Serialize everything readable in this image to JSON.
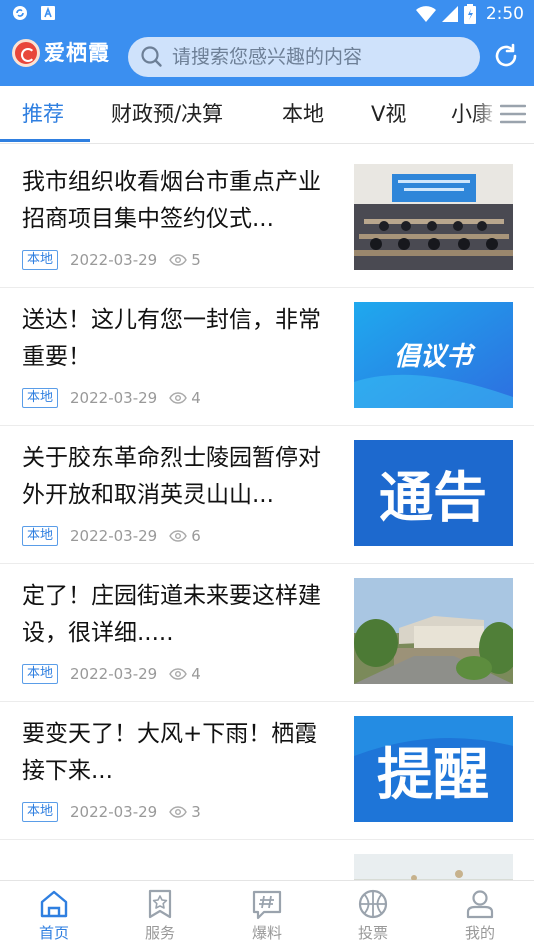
{
  "status_bar": {
    "time": "2:50"
  },
  "header": {
    "app_name": "爱栖霞",
    "search_placeholder": "请搜索您感兴趣的内容"
  },
  "tabs": [
    {
      "label": "推荐",
      "active": true
    },
    {
      "label": "财政预/决算"
    },
    {
      "label": "本地"
    },
    {
      "label": "V视"
    },
    {
      "label": "小康"
    }
  ],
  "feed": [
    {
      "title": "我市组织收看烟台市重点产业招商项目集中签约仪式...",
      "tag": "本地",
      "date": "2022-03-29",
      "views": "5"
    },
    {
      "title": "送达！这儿有您一封信，非常重要！",
      "tag": "本地",
      "date": "2022-03-29",
      "views": "4",
      "thumb_text": "倡议书"
    },
    {
      "title": "关于胶东革命烈士陵园暂停对外开放和取消英灵山山...",
      "tag": "本地",
      "date": "2022-03-29",
      "views": "6",
      "thumb_text": "通告"
    },
    {
      "title": "定了！庄园街道未来要这样建设，很详细.....",
      "tag": "本地",
      "date": "2022-03-29",
      "views": "4"
    },
    {
      "title": "要变天了！大风+下雨！栖霞接下来...",
      "tag": "本地",
      "date": "2022-03-29",
      "views": "3",
      "thumb_text": "提醒"
    }
  ],
  "bottom_nav": [
    {
      "label": "首页",
      "icon": "home-icon",
      "active": true
    },
    {
      "label": "服务",
      "icon": "bookmark-star-icon"
    },
    {
      "label": "爆料",
      "icon": "hash-chat-icon"
    },
    {
      "label": "投票",
      "icon": "basketball-icon"
    },
    {
      "label": "我的",
      "icon": "person-icon"
    }
  ],
  "colors": {
    "primary": "#3b8ff0",
    "accent": "#2f7fe0"
  }
}
